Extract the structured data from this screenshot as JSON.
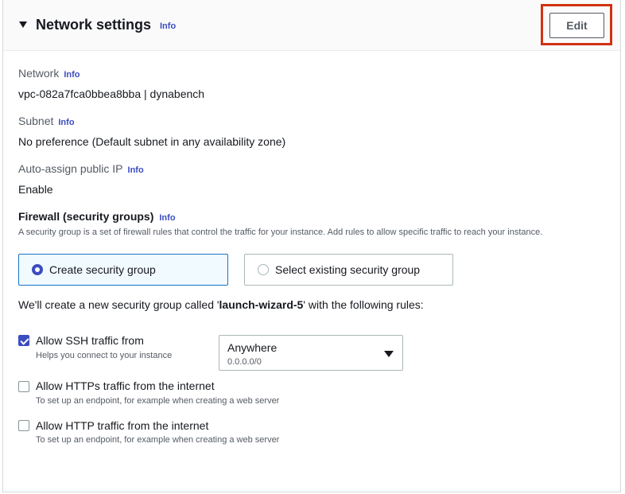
{
  "section": {
    "title": "Network settings",
    "info": "Info",
    "edit_label": "Edit"
  },
  "network": {
    "label": "Network",
    "info": "Info",
    "value": "vpc-082a7fca0bbea8bba | dynabench"
  },
  "subnet": {
    "label": "Subnet",
    "info": "Info",
    "value": "No preference (Default subnet in any availability zone)"
  },
  "public_ip": {
    "label": "Auto-assign public IP",
    "info": "Info",
    "value": "Enable"
  },
  "firewall": {
    "title": "Firewall (security groups)",
    "info": "Info",
    "description": "A security group is a set of firewall rules that control the traffic for your instance. Add rules to allow specific traffic to reach your instance.",
    "options": [
      {
        "label": "Create security group",
        "selected": true
      },
      {
        "label": "Select existing security group",
        "selected": false
      }
    ],
    "create_prefix": "We'll create a new security group called '",
    "group_name": "launch-wizard-5",
    "create_suffix": "' with the following rules:"
  },
  "rules": [
    {
      "label": "Allow SSH traffic from",
      "description": "Helps you connect to your instance",
      "checked": true
    },
    {
      "label": "Allow HTTPs traffic from the internet",
      "description": "To set up an endpoint, for example when creating a web server",
      "checked": false
    },
    {
      "label": "Allow HTTP traffic from the internet",
      "description": "To set up an endpoint, for example when creating a web server",
      "checked": false
    }
  ],
  "ssh_source": {
    "value": "Anywhere",
    "sub": "0.0.0.0/0",
    "icon": "caret-down-icon"
  },
  "colors": {
    "accent": "#3b4dbf",
    "highlight": "#d13212",
    "selected_tile_bg": "#f1faff"
  }
}
